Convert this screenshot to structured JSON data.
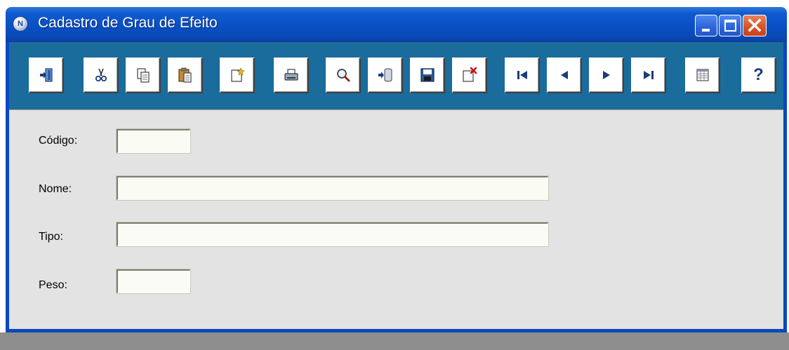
{
  "window": {
    "title": "Cadastro de Grau de Efeito",
    "app_icon_letter": "N",
    "colors": {
      "titlebar": "#0850c4",
      "toolbar": "#1a6c9c",
      "content": "#e3e3e3",
      "close": "#d75426"
    }
  },
  "toolbar": {
    "buttons": [
      {
        "icon": "exit-door-icon"
      },
      {
        "icon": "cut-scissors-icon"
      },
      {
        "icon": "copy-icon"
      },
      {
        "icon": "paste-clipboard-icon"
      },
      {
        "icon": "new-record-icon"
      },
      {
        "icon": "print-icon"
      },
      {
        "icon": "search-magnifier-icon"
      },
      {
        "icon": "open-database-icon"
      },
      {
        "icon": "save-floppy-icon"
      },
      {
        "icon": "delete-record-icon"
      },
      {
        "icon": "first-record-icon"
      },
      {
        "icon": "previous-record-icon"
      },
      {
        "icon": "next-record-icon"
      },
      {
        "icon": "last-record-icon"
      },
      {
        "icon": "table-grid-icon"
      },
      {
        "icon": "help-question-icon",
        "glyph": "?"
      }
    ]
  },
  "form": {
    "codigo": {
      "label": "Código:",
      "value": ""
    },
    "nome": {
      "label": "Nome:",
      "value": ""
    },
    "tipo": {
      "label": "Tipo:",
      "value": ""
    },
    "peso": {
      "label": "Peso:",
      "value": ""
    }
  }
}
